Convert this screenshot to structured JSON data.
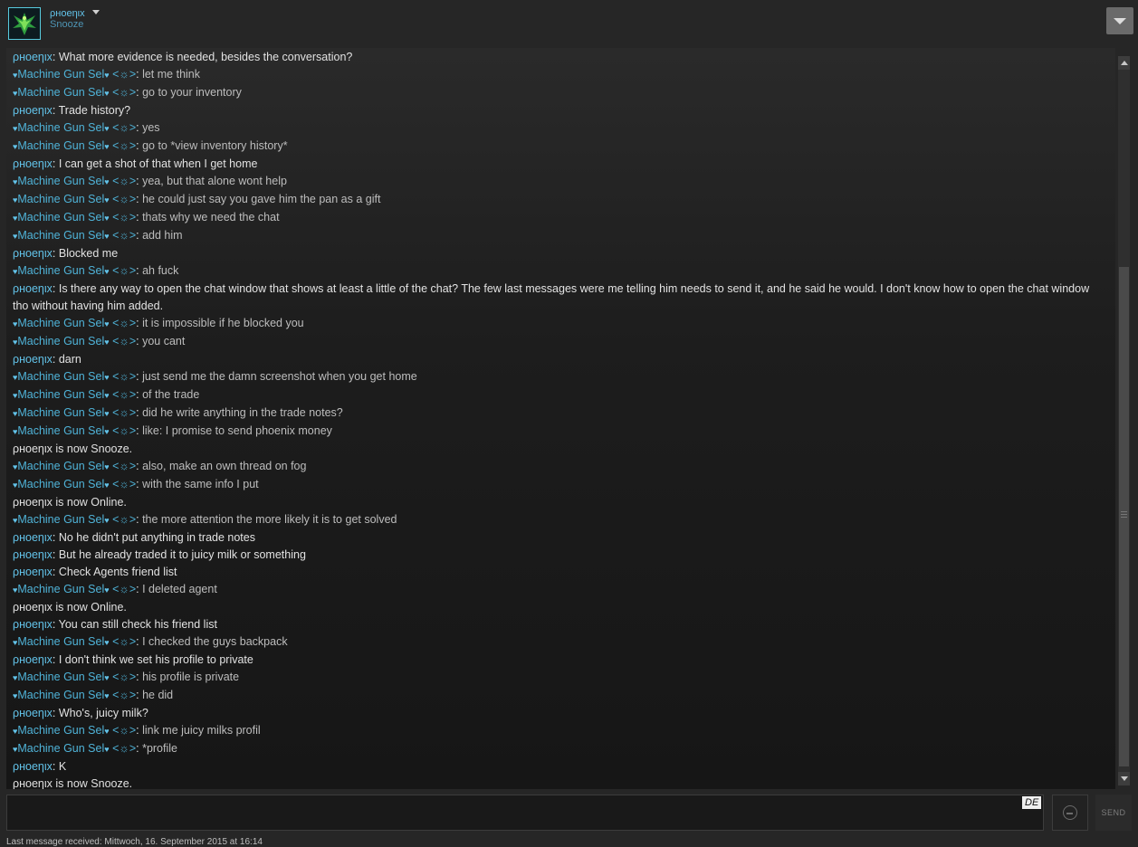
{
  "header": {
    "username": "ρнoeηιx",
    "status": "Snooze",
    "avatar_icon": "phoenix-avatar-icon",
    "menu_icon": "chevron-down-icon"
  },
  "colors": {
    "sender_name": "#62c2e8",
    "message_text": "#e2e2e2",
    "background": "#262626"
  },
  "messages": [
    {
      "type": "msg",
      "sender": "ρнoeηιx",
      "who": "phoenix",
      "text": "What more evidence is needed, besides the conversation?"
    },
    {
      "type": "msg",
      "sender": "Machine Gun Sel",
      "who": "mgs",
      "text": "let me think"
    },
    {
      "type": "msg",
      "sender": "Machine Gun Sel",
      "who": "mgs",
      "text": "go to your inventory"
    },
    {
      "type": "msg",
      "sender": "ρнoeηιx",
      "who": "phoenix",
      "text": "Trade history?"
    },
    {
      "type": "msg",
      "sender": "Machine Gun Sel",
      "who": "mgs",
      "text": "yes"
    },
    {
      "type": "msg",
      "sender": "Machine Gun Sel",
      "who": "mgs",
      "text": "go to *view inventory history*"
    },
    {
      "type": "msg",
      "sender": "ρнoeηιx",
      "who": "phoenix",
      "text": "I can get a shot of that when I get home"
    },
    {
      "type": "msg",
      "sender": "Machine Gun Sel",
      "who": "mgs",
      "text": "yea, but that alone wont help"
    },
    {
      "type": "msg",
      "sender": "Machine Gun Sel",
      "who": "mgs",
      "text": "he could just say you gave him the pan as a gift"
    },
    {
      "type": "msg",
      "sender": "Machine Gun Sel",
      "who": "mgs",
      "text": "thats why we need the chat"
    },
    {
      "type": "msg",
      "sender": "Machine Gun Sel",
      "who": "mgs",
      "text": "add him"
    },
    {
      "type": "msg",
      "sender": "ρнoeηιx",
      "who": "phoenix",
      "text": "Blocked me"
    },
    {
      "type": "msg",
      "sender": "Machine Gun Sel",
      "who": "mgs",
      "text": "ah fuck"
    },
    {
      "type": "msg",
      "sender": "ρнoeηιx",
      "who": "phoenix",
      "text": "Is there any way to open the chat window that shows at least a little of the chat? The few last messages were me telling him needs to send it, and he said he would. I don't know how to open the chat window tho without having him added."
    },
    {
      "type": "msg",
      "sender": "Machine Gun Sel",
      "who": "mgs",
      "text": "it is impossible if he blocked you"
    },
    {
      "type": "msg",
      "sender": "Machine Gun Sel",
      "who": "mgs",
      "text": "you cant"
    },
    {
      "type": "msg",
      "sender": "ρнoeηιx",
      "who": "phoenix",
      "text": "darn"
    },
    {
      "type": "msg",
      "sender": "Machine Gun Sel",
      "who": "mgs",
      "text": "just send me the damn screenshot when you get home"
    },
    {
      "type": "msg",
      "sender": "Machine Gun Sel",
      "who": "mgs",
      "text": "of the trade"
    },
    {
      "type": "msg",
      "sender": "Machine Gun Sel",
      "who": "mgs",
      "text": "did he write anything in the trade notes?"
    },
    {
      "type": "msg",
      "sender": "Machine Gun Sel",
      "who": "mgs",
      "text": "like: I promise to send phoenix money"
    },
    {
      "type": "status",
      "text": "ρнoeηιx is now Snooze."
    },
    {
      "type": "msg",
      "sender": "Machine Gun Sel",
      "who": "mgs",
      "text": "also, make an own thread on fog"
    },
    {
      "type": "msg",
      "sender": "Machine Gun Sel",
      "who": "mgs",
      "text": "with the same info I put"
    },
    {
      "type": "status",
      "text": "ρнoeηιx is now Online."
    },
    {
      "type": "msg",
      "sender": "Machine Gun Sel",
      "who": "mgs",
      "text": "the more attention the more likely it is to get solved"
    },
    {
      "type": "msg",
      "sender": "ρнoeηιx",
      "who": "phoenix",
      "text": "No he didn't put anything in trade notes"
    },
    {
      "type": "msg",
      "sender": "ρнoeηιx",
      "who": "phoenix",
      "text": "But he already traded it to juicy milk or something"
    },
    {
      "type": "msg",
      "sender": "ρнoeηιx",
      "who": "phoenix",
      "text": "Check Agents friend list"
    },
    {
      "type": "msg",
      "sender": "Machine Gun Sel",
      "who": "mgs",
      "text": "I deleted agent"
    },
    {
      "type": "status",
      "text": "ρнoeηιx is now Online."
    },
    {
      "type": "msg",
      "sender": "ρнoeηιx",
      "who": "phoenix",
      "text": "You can still check his friend list"
    },
    {
      "type": "msg",
      "sender": "Machine Gun Sel",
      "who": "mgs",
      "text": "I checked the guys backpack"
    },
    {
      "type": "msg",
      "sender": "ρнoeηιx",
      "who": "phoenix",
      "text": "I don't think we set his profile to private"
    },
    {
      "type": "msg",
      "sender": "Machine Gun Sel",
      "who": "mgs",
      "text": "his profile is private"
    },
    {
      "type": "msg",
      "sender": "Machine Gun Sel",
      "who": "mgs",
      "text": "he did"
    },
    {
      "type": "msg",
      "sender": "ρнoeηιx",
      "who": "phoenix",
      "text": "Who's, juicy milk?"
    },
    {
      "type": "msg",
      "sender": "Machine Gun Sel",
      "who": "mgs",
      "text": "link me juicy milks profil"
    },
    {
      "type": "msg",
      "sender": "Machine Gun Sel",
      "who": "mgs",
      "text": "*profile"
    },
    {
      "type": "msg",
      "sender": "ρнoeηιx",
      "who": "phoenix",
      "text": "K"
    },
    {
      "type": "status",
      "text": "ρнoeηιx is now Snooze."
    }
  ],
  "mgs_suffix": "<☼>",
  "input": {
    "value": "",
    "placeholder": "",
    "language_badge": "DE"
  },
  "emoticon_icon": "smiley-icon",
  "send_button": "SEND",
  "footer": "Last message received: Mittwoch, 16. September 2015 at 16:14"
}
